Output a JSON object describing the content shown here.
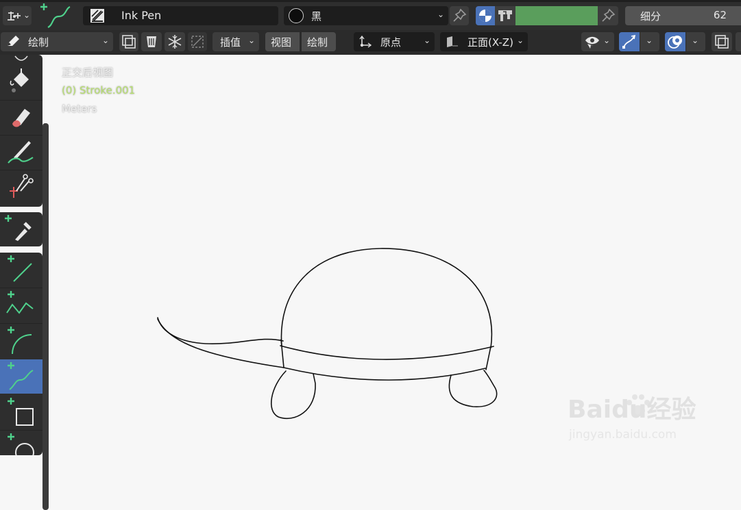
{
  "header": {
    "brush_name": "Ink Pen",
    "material_name": "黑",
    "subdivision": {
      "label": "细分",
      "value": "62"
    },
    "vertex_color": "#5a9e5c"
  },
  "toolbar2": {
    "mode_label": "绘制",
    "interpolate_label": "插值",
    "view_label": "视图",
    "draw_label": "绘制",
    "origin_label": "原点",
    "orientation_label": "正面(X-Z)"
  },
  "tools": [
    {
      "name": "fill",
      "icon": "bucket-icon"
    },
    {
      "name": "erase",
      "icon": "eraser-icon"
    },
    {
      "name": "tint",
      "icon": "tint-brush-icon"
    },
    {
      "name": "cutter",
      "icon": "scissors-icon"
    },
    {
      "name": "eyedropper",
      "icon": "eyedropper-icon"
    },
    {
      "name": "line",
      "icon": "line-icon"
    },
    {
      "name": "polyline",
      "icon": "polyline-icon"
    },
    {
      "name": "arc",
      "icon": "arc-icon"
    },
    {
      "name": "curve",
      "icon": "curve-icon",
      "active": true
    },
    {
      "name": "box",
      "icon": "box-icon"
    },
    {
      "name": "circle",
      "icon": "circle-icon"
    }
  ],
  "viewport": {
    "view_name": "正交后视图",
    "object_name": "(0) Stroke.001",
    "units": "Meters"
  },
  "watermark": {
    "brand": "Baidu经验",
    "url": "jingyan.baidu.com"
  },
  "colors": {
    "accent_blue": "#4a72b8",
    "object_green": "#b7df6f",
    "tool_plus_green": "#4fd18c"
  }
}
